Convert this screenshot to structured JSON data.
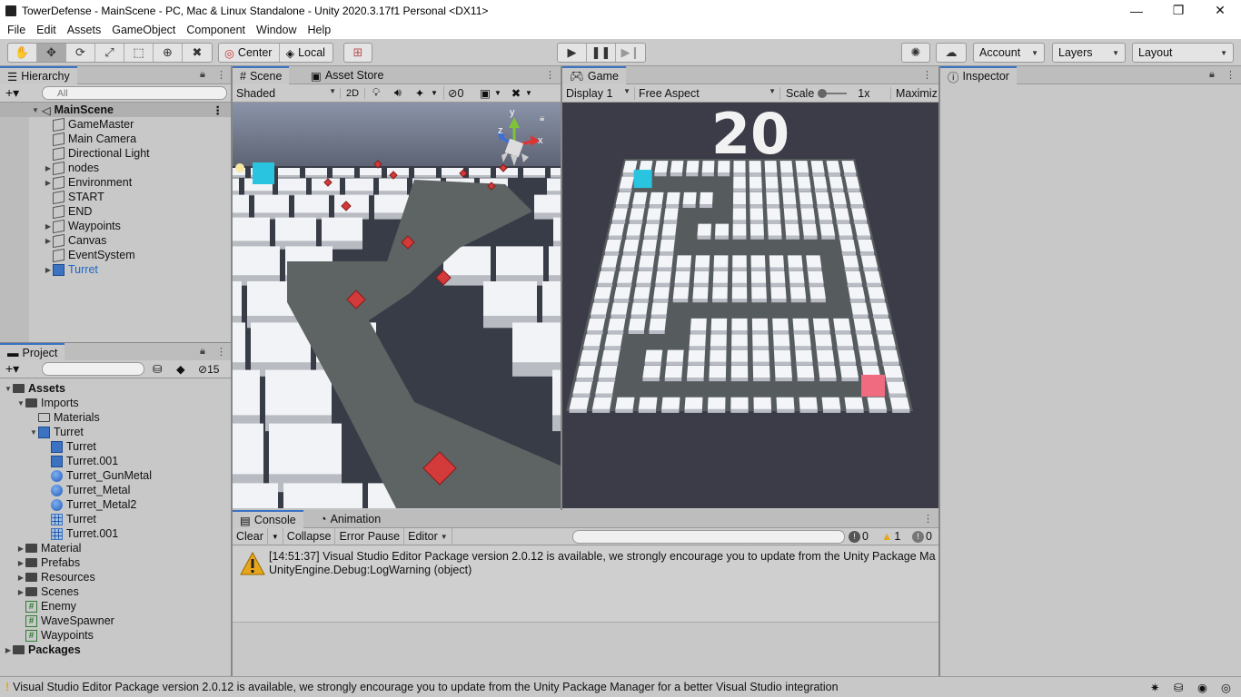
{
  "window": {
    "title": "TowerDefense - MainScene - PC, Mac & Linux Standalone - Unity 2020.3.17f1 Personal <DX11>",
    "minimize": "—",
    "maximize": "❐",
    "close": "✕"
  },
  "menu": [
    "File",
    "Edit",
    "Assets",
    "GameObject",
    "Component",
    "Window",
    "Help"
  ],
  "toolbar": {
    "pivot": "Center",
    "space": "Local",
    "account": "Account",
    "layers": "Layers",
    "layout": "Layout"
  },
  "hierarchy": {
    "tab": "Hierarchy",
    "search_placeholder": "All",
    "scene": "MainScene",
    "items": [
      {
        "label": "GameMaster",
        "expandable": false
      },
      {
        "label": "Main Camera",
        "expandable": false
      },
      {
        "label": "Directional Light",
        "expandable": false
      },
      {
        "label": "nodes",
        "expandable": true
      },
      {
        "label": "Environment",
        "expandable": true
      },
      {
        "label": "START",
        "expandable": false
      },
      {
        "label": "END",
        "expandable": false
      },
      {
        "label": "Waypoints",
        "expandable": true
      },
      {
        "label": "Canvas",
        "expandable": true
      },
      {
        "label": "EventSystem",
        "expandable": false
      },
      {
        "label": "Turret",
        "expandable": true,
        "prefab": true
      }
    ]
  },
  "project": {
    "tab": "Project",
    "hidden_count": "15",
    "items": [
      {
        "label": "Assets",
        "depth": 0,
        "type": "folder",
        "fold": "open",
        "bold": true
      },
      {
        "label": "Imports",
        "depth": 1,
        "type": "folder",
        "fold": "open"
      },
      {
        "label": "Materials",
        "depth": 2,
        "type": "folder-empty",
        "fold": "none"
      },
      {
        "label": "Turret",
        "depth": 2,
        "type": "prefab",
        "fold": "open"
      },
      {
        "label": "Turret",
        "depth": 3,
        "type": "prefab",
        "fold": "none"
      },
      {
        "label": "Turret.001",
        "depth": 3,
        "type": "prefab",
        "fold": "none"
      },
      {
        "label": "Turret_GunMetal",
        "depth": 3,
        "type": "material",
        "fold": "none"
      },
      {
        "label": "Turret_Metal",
        "depth": 3,
        "type": "material",
        "fold": "none"
      },
      {
        "label": "Turret_Metal2",
        "depth": 3,
        "type": "material",
        "fold": "none"
      },
      {
        "label": "Turret",
        "depth": 3,
        "type": "mesh",
        "fold": "none"
      },
      {
        "label": "Turret.001",
        "depth": 3,
        "type": "mesh",
        "fold": "none"
      },
      {
        "label": "Material",
        "depth": 1,
        "type": "folder",
        "fold": "closed"
      },
      {
        "label": "Prefabs",
        "depth": 1,
        "type": "folder",
        "fold": "closed"
      },
      {
        "label": "Resources",
        "depth": 1,
        "type": "folder",
        "fold": "closed"
      },
      {
        "label": "Scenes",
        "depth": 1,
        "type": "folder",
        "fold": "closed"
      },
      {
        "label": "Enemy",
        "depth": 1,
        "type": "script",
        "fold": "none"
      },
      {
        "label": "WaveSpawner",
        "depth": 1,
        "type": "script",
        "fold": "none"
      },
      {
        "label": "Waypoints",
        "depth": 1,
        "type": "script",
        "fold": "none"
      },
      {
        "label": "Packages",
        "depth": 0,
        "type": "folder",
        "fold": "closed",
        "bold": true
      }
    ]
  },
  "scene": {
    "tab": "Scene",
    "tab2": "Asset Store",
    "shading": "Shaded",
    "mode2d": "2D",
    "hidden": "0",
    "gizmo": {
      "x": "x",
      "y": "y",
      "z": "z"
    }
  },
  "game": {
    "tab": "Game",
    "display": "Display 1",
    "aspect": "Free Aspect",
    "scale_label": "Scale",
    "scale_value": "1x",
    "maximize": "Maximiz",
    "countdown": "20"
  },
  "inspector": {
    "tab": "Inspector"
  },
  "console": {
    "tab": "Console",
    "tab2": "Animation",
    "clear": "Clear",
    "collapse": "Collapse",
    "error_pause": "Error Pause",
    "editor": "Editor",
    "count_info": "0",
    "count_warn": "1",
    "count_error": "0",
    "log_line1": "[14:51:37] Visual Studio Editor Package version 2.0.12 is available, we strongly encourage you to update from the Unity Package Ma",
    "log_line2": "UnityEngine.Debug:LogWarning (object)"
  },
  "status": {
    "message": "Visual Studio Editor Package version 2.0.12 is available, we strongly encourage you to update from the Unity Package Manager for a better Visual Studio integration"
  },
  "colors": {
    "accent": "#3a72c4",
    "turret": "#1f66c8",
    "warning": "#e7a61a",
    "start_cube": "#29c5e0",
    "end_cube": "#f06a80",
    "waypoint": "#d33a3a"
  }
}
